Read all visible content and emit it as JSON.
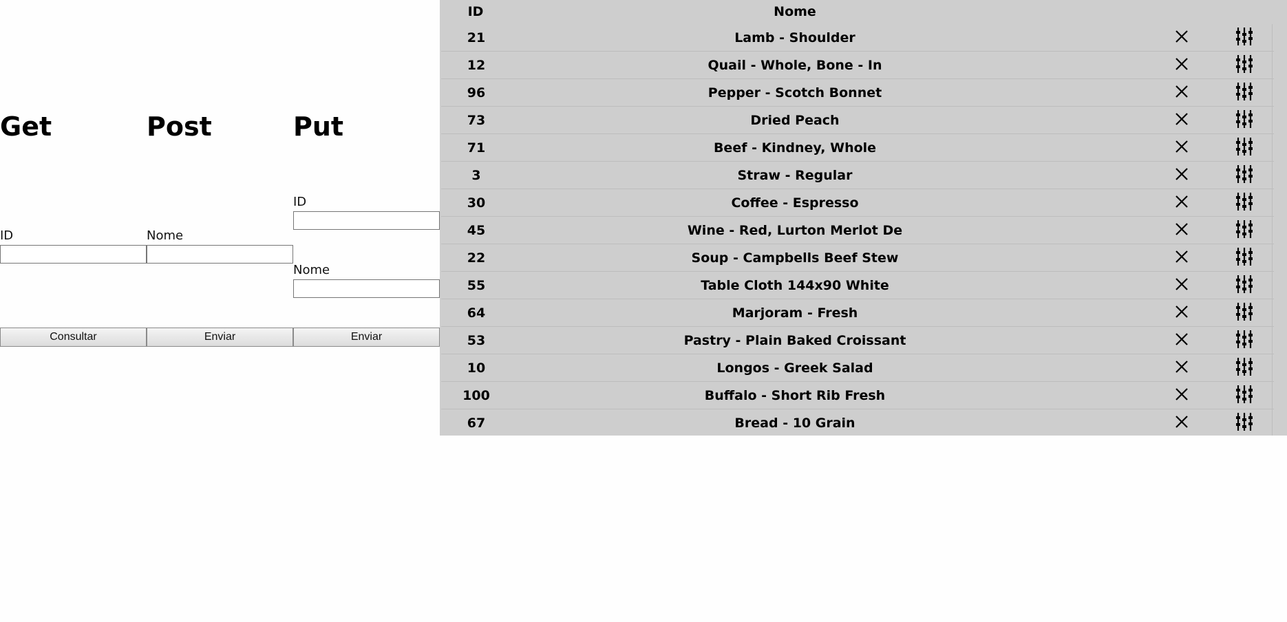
{
  "get": {
    "heading": "Get",
    "id_label": "ID",
    "id_value": "",
    "button_label": "Consultar"
  },
  "post": {
    "heading": "Post",
    "nome_label": "Nome",
    "nome_value": "",
    "button_label": "Enviar"
  },
  "put": {
    "heading": "Put",
    "id_label": "ID",
    "id_value": "",
    "nome_label": "Nome",
    "nome_value": "",
    "button_label": "Enviar"
  },
  "table": {
    "columns": [
      "ID",
      "Nome"
    ],
    "delete_icon": "close-icon",
    "edit_icon": "sliders-icon",
    "rows": [
      {
        "id": "21",
        "nome": "Lamb - Shoulder"
      },
      {
        "id": "12",
        "nome": "Quail - Whole, Bone - In"
      },
      {
        "id": "96",
        "nome": "Pepper - Scotch Bonnet"
      },
      {
        "id": "73",
        "nome": "Dried Peach"
      },
      {
        "id": "71",
        "nome": "Beef - Kindney, Whole"
      },
      {
        "id": "3",
        "nome": "Straw - Regular"
      },
      {
        "id": "30",
        "nome": "Coffee - Espresso"
      },
      {
        "id": "45",
        "nome": "Wine - Red, Lurton Merlot De"
      },
      {
        "id": "22",
        "nome": "Soup - Campbells Beef Stew"
      },
      {
        "id": "55",
        "nome": "Table Cloth 144x90 White"
      },
      {
        "id": "64",
        "nome": "Marjoram - Fresh"
      },
      {
        "id": "53",
        "nome": "Pastry - Plain Baked Croissant"
      },
      {
        "id": "10",
        "nome": "Longos - Greek Salad"
      },
      {
        "id": "100",
        "nome": "Buffalo - Short Rib Fresh"
      },
      {
        "id": "67",
        "nome": "Bread - 10 Grain"
      },
      {
        "id": "",
        "nome": ""
      }
    ]
  }
}
